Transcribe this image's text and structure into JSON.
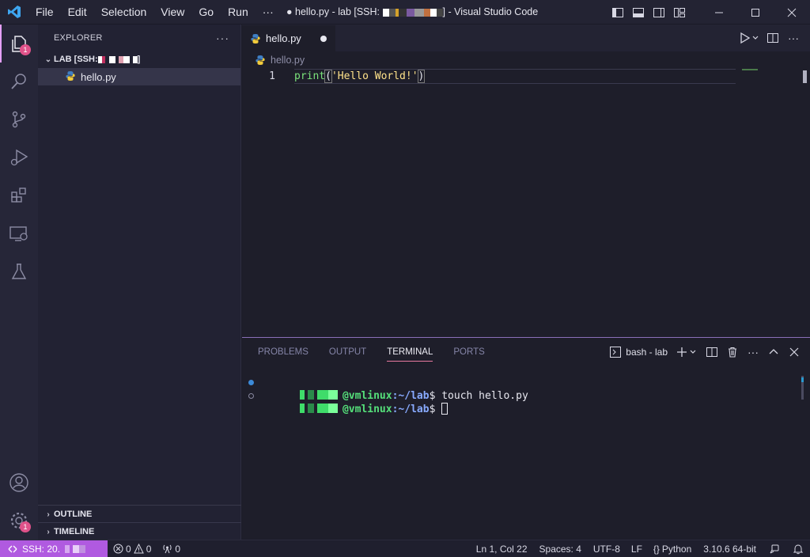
{
  "window": {
    "title_prefix": "● hello.py - lab [SSH: ",
    "title_suffix": "] - Visual Studio Code"
  },
  "menu": [
    "File",
    "Edit",
    "Selection",
    "View",
    "Go",
    "Run",
    "···"
  ],
  "activity_bar": {
    "explorer_badge": "1",
    "manage_badge": "1"
  },
  "sidebar": {
    "header": "EXPLORER",
    "folder_label": "LAB [SSH: ",
    "file": "hello.py",
    "outline": "OUTLINE",
    "timeline": "TIMELINE"
  },
  "editor": {
    "tab_label": "hello.py",
    "breadcrumb": "hello.py",
    "line_number": "1",
    "code": {
      "func": "print",
      "open": "(",
      "string": "'Hello World!'",
      "close": ")"
    }
  },
  "panel": {
    "tabs": [
      "PROBLEMS",
      "OUTPUT",
      "TERMINAL",
      "PORTS"
    ],
    "active_tab": "TERMINAL",
    "terminal_name": "bash - lab",
    "lines": [
      {
        "host": "@vmlinux",
        "path": ":~/lab",
        "prompt": "$ ",
        "cmd": "touch hello.py"
      },
      {
        "host": "@vmlinux",
        "path": ":~/lab",
        "prompt": "$ ",
        "cmd": ""
      }
    ]
  },
  "status_bar": {
    "remote": "SSH: 20.",
    "errors": "0",
    "warnings": "0",
    "ports": "0",
    "position": "Ln 1, Col 22",
    "spaces": "Spaces: 4",
    "encoding": "UTF-8",
    "eol": "LF",
    "language": "Python",
    "interpreter": "3.10.6 64-bit"
  },
  "colors": {
    "accent": "#b05ae0",
    "badge": "#e0528a",
    "panel_border": "#8a6fb8"
  }
}
